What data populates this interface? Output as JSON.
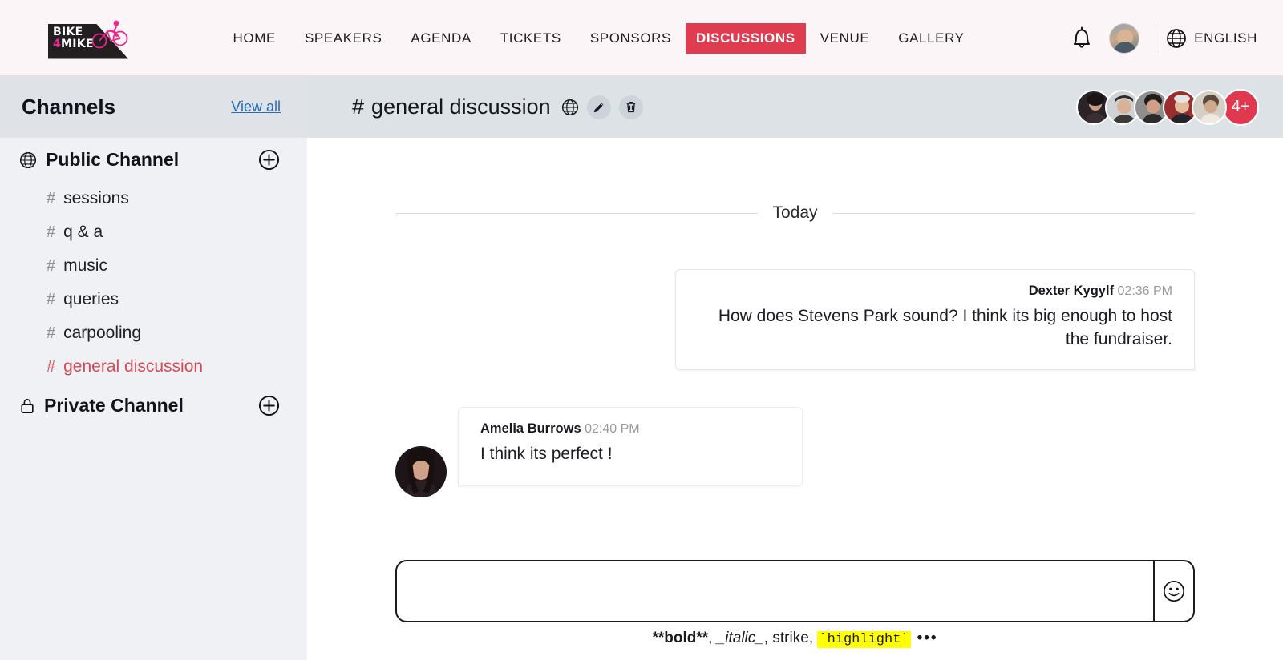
{
  "brand": {
    "logo_line1": "BIKE",
    "logo_line2_pre": "4",
    "logo_line2_post": "MIKE",
    "accent_pink": "#ec268f",
    "accent_red": "#e03c50"
  },
  "nav": {
    "items": [
      {
        "label": "HOME",
        "active": false
      },
      {
        "label": "SPEAKERS",
        "active": false
      },
      {
        "label": "AGENDA",
        "active": false
      },
      {
        "label": "TICKETS",
        "active": false
      },
      {
        "label": "SPONSORS",
        "active": false
      },
      {
        "label": "DISCUSSIONS",
        "active": true
      },
      {
        "label": "VENUE",
        "active": false
      },
      {
        "label": "GALLERY",
        "active": false
      }
    ],
    "notification_icon": "bell-icon",
    "avatar_icon": "user-avatar",
    "globe_icon": "globe-icon",
    "language": "ENGLISH"
  },
  "sidebar": {
    "title": "Channels",
    "view_all": "View all",
    "groups": [
      {
        "label": "Public Channel",
        "icon": "globe-icon",
        "add_icon": "plus-circle-icon",
        "channels": [
          {
            "hash": "#",
            "label": "sessions",
            "active": false
          },
          {
            "hash": "#",
            "label": "q & a",
            "active": false
          },
          {
            "hash": "#",
            "label": "music",
            "active": false
          },
          {
            "hash": "#",
            "label": "queries",
            "active": false
          },
          {
            "hash": "#",
            "label": "carpooling",
            "active": false
          },
          {
            "hash": "#",
            "label": "general discussion",
            "active": true
          }
        ]
      },
      {
        "label": "Private Channel",
        "icon": "lock-icon",
        "add_icon": "plus-circle-icon",
        "channels": []
      }
    ]
  },
  "chat_header": {
    "channel_hash": "#",
    "channel_name": "general discussion",
    "visibility_icon": "globe-icon",
    "edit_icon": "pencil-icon",
    "delete_icon": "trash-icon",
    "members_overflow": "4+",
    "members": [
      {
        "name": "member-1"
      },
      {
        "name": "member-2"
      },
      {
        "name": "member-3"
      },
      {
        "name": "member-4"
      },
      {
        "name": "member-5"
      }
    ]
  },
  "conversation": {
    "day_label": "Today",
    "messages": [
      {
        "author": "Dexter Kygylf",
        "time": "02:36 PM",
        "text": "How does Stevens Park sound? I think its big enough to host the fundraiser.",
        "direction": "outgoing"
      },
      {
        "author": "Amelia Burrows",
        "time": "02:40 PM",
        "text": "I think its perfect !",
        "direction": "incoming"
      }
    ]
  },
  "composer": {
    "value": "",
    "placeholder": "",
    "emoji_icon": "smiley-icon",
    "hints": {
      "bold": "**bold**",
      "sep1": ", ",
      "italic": "_italic_",
      "sep2": ", ",
      "strike": "strike",
      "sep3": ", ",
      "highlight": "`highlight`",
      "more": "•••"
    }
  }
}
